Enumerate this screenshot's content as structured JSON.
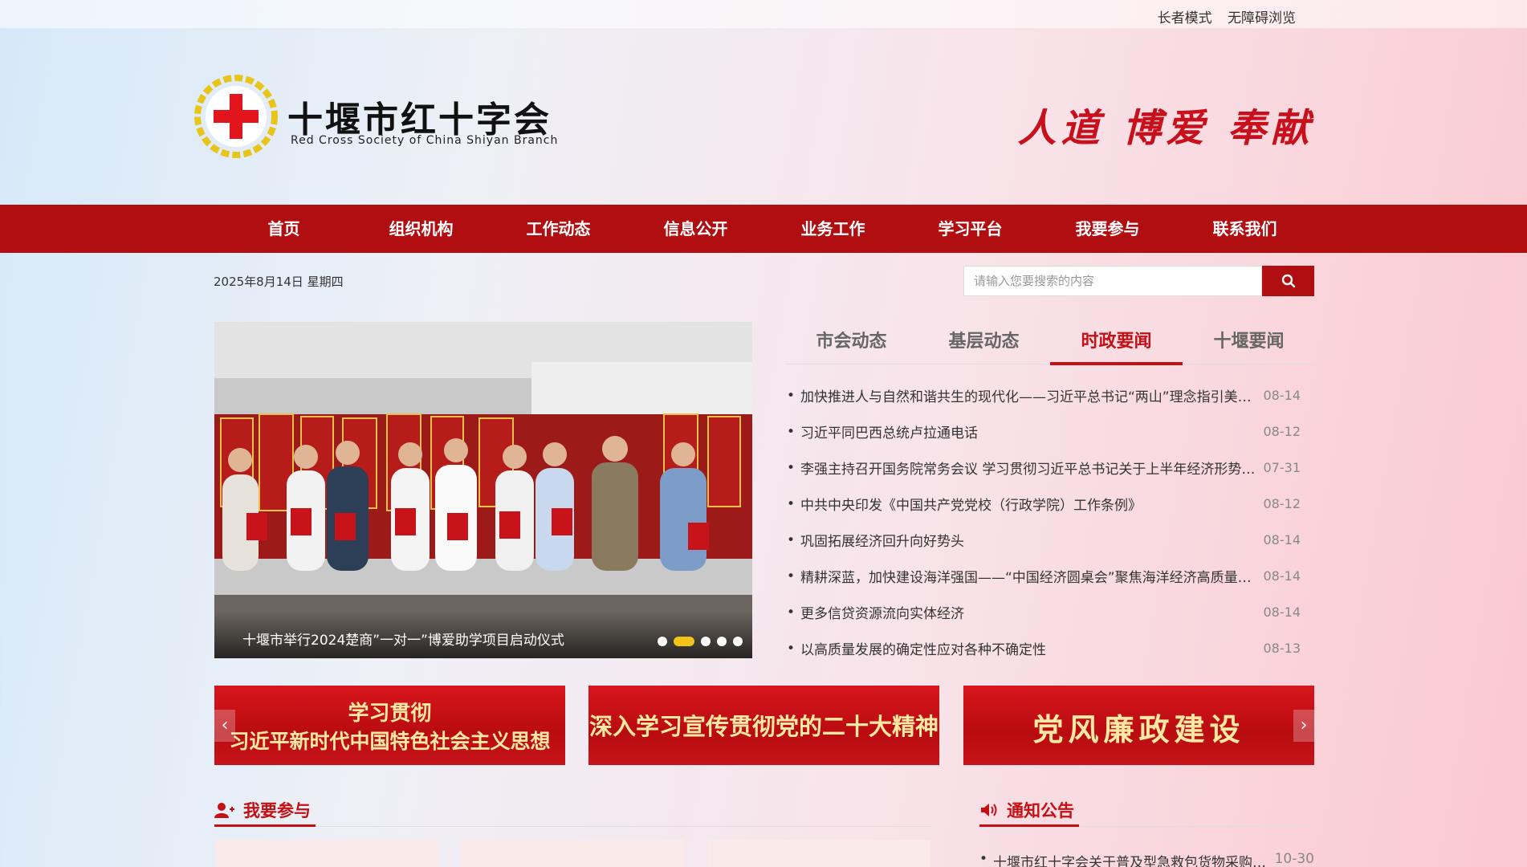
{
  "topbar": {
    "elder_mode": "长者模式",
    "accessible": "无障碍浏览"
  },
  "header": {
    "org_name_cn": "十堰市红十字会",
    "org_name_en": "Red Cross Society of China Shiyan Branch",
    "slogan": "人道 博爱 奉献",
    "brand_color": "#c8101d"
  },
  "nav": {
    "items": [
      {
        "label": "首页"
      },
      {
        "label": "组织机构"
      },
      {
        "label": "工作动态"
      },
      {
        "label": "信息公开"
      },
      {
        "label": "业务工作"
      },
      {
        "label": "学习平台"
      },
      {
        "label": "我要参与"
      },
      {
        "label": "联系我们"
      }
    ],
    "bg_color": "#b10e12"
  },
  "date_text": "2025年8月14日 星期四",
  "search": {
    "placeholder": "请输入您要搜索的内容",
    "icon": "search-icon"
  },
  "slider": {
    "caption": "十堰市举行2024楚商”一对一”博爱助学项目启动仪式",
    "dot_count": 5,
    "active_dot": 2
  },
  "tabs": [
    {
      "label": "市会动态"
    },
    {
      "label": "基层动态"
    },
    {
      "label": "时政要闻",
      "active": true
    },
    {
      "label": "十堰要闻"
    }
  ],
  "news": [
    {
      "title": "加快推进人与自然和谐共生的现代化——习近平总书记“两山”理念指引美丽中国建设",
      "date": "08-14"
    },
    {
      "title": "习近平同巴西总统卢拉通电话",
      "date": "08-12"
    },
    {
      "title": "李强主持召开国务院常务会议 学习贯彻习近平总书记关于上半年经济形势的重要讲话精神",
      "date": "07-31"
    },
    {
      "title": "中共中央印发《中国共产党党校（行政学院）工作条例》",
      "date": "08-12"
    },
    {
      "title": "巩固拓展经济回升向好势头",
      "date": "08-14"
    },
    {
      "title": "精耕深蓝，加快建设海洋强国——“中国经济圆桌会”聚焦海洋经济高质量发展",
      "date": "08-14"
    },
    {
      "title": "更多信贷资源流向实体经济",
      "date": "08-14"
    },
    {
      "title": "以高质量发展的确定性应对各种不确定性",
      "date": "08-13"
    }
  ],
  "banners": [
    {
      "line1": "学习贯彻",
      "line2": "习近平新时代中国特色社会主义思想"
    },
    {
      "line1": "深入学习宣传贯彻党的二十大精神"
    },
    {
      "line1": "党风廉政建设"
    }
  ],
  "sections": {
    "participate": {
      "title": "我要参与",
      "icon": "user-add-icon"
    },
    "notice": {
      "title": "通知公告",
      "icon": "speaker-icon",
      "first_item": "十堰市红十字会关于普及型急救包货物采购项目公告",
      "first_date": "10-30"
    }
  }
}
